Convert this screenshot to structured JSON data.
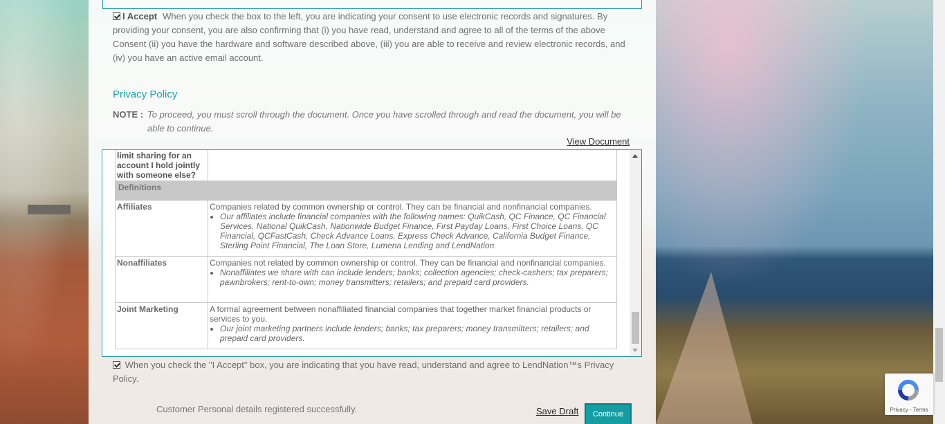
{
  "consent": {
    "accept_label": "I Accept",
    "text": "When you check the box to the left, you are indicating your consent to use electronic records and signatures.  By providing your consent, you are also confirming that (i) you have read, understand and agree to all of the terms of the above Consent (ii) you have the hardware and software described above, (iii) you are able to receive and review electronic records, and (iv) you have an active email account.",
    "checked": true
  },
  "privacy": {
    "title": "Privacy Policy",
    "note_label": "NOTE :",
    "note_text": "To proceed, you must scroll through the document. Once you have scrolled through and read the document, you will be able to continue.",
    "view_document": "View Document"
  },
  "document": {
    "partial_question": "limit sharing for an account I hold jointly with someone else?",
    "definitions_heading": "Definitions",
    "rows": [
      {
        "term": "Affiliates",
        "definition": "Companies related by common ownership or control. They can be financial and nonfinancial companies.",
        "bullet": "Our affiliates include financial companies with the following names: QuikCash, QC Finance, QC Financial Services, National QuikCash, Nationwide Budget Finance, First Payday Loans, First Choice Loans, QC Financial, QCFastCash, Check Advance Loans, Express Check Advance, California Budget Finance, Sterling Point Financial, The Loan Store, Lumena Lending and LendNation."
      },
      {
        "term": "Nonaffiliates",
        "definition": "Companies not related by common ownership or control. They can be financial and nonfinancial companies.",
        "bullet": "Nonaffiliates we share with can include lenders; banks; collection agencies; check-cashers; tax preparers; pawnbrokers; rent-to-own; money transmitters; retailers; and prepaid card providers."
      },
      {
        "term": "Joint Marketing",
        "definition": "A formal agreement between nonaffiliated financial companies that together market financial products or services to you.",
        "bullet": "Our joint marketing partners include lenders; banks; tax preparers; money transmitters; retailers; and prepaid card providers."
      }
    ]
  },
  "agree": {
    "text": "When you check the \"I Accept\" box, you are indicating that you have read, understand and agree to LendNation™s Privacy Policy.",
    "checked": true
  },
  "footer": {
    "status": "Customer Personal details registered successfully.",
    "save_draft": "Save Draft",
    "continue": "Continue"
  },
  "recaptcha": {
    "links": "Privacy - Terms",
    "icon": "recaptcha-logo"
  },
  "colors": {
    "accent": "#1f9fa4",
    "button": "#149ea3"
  }
}
